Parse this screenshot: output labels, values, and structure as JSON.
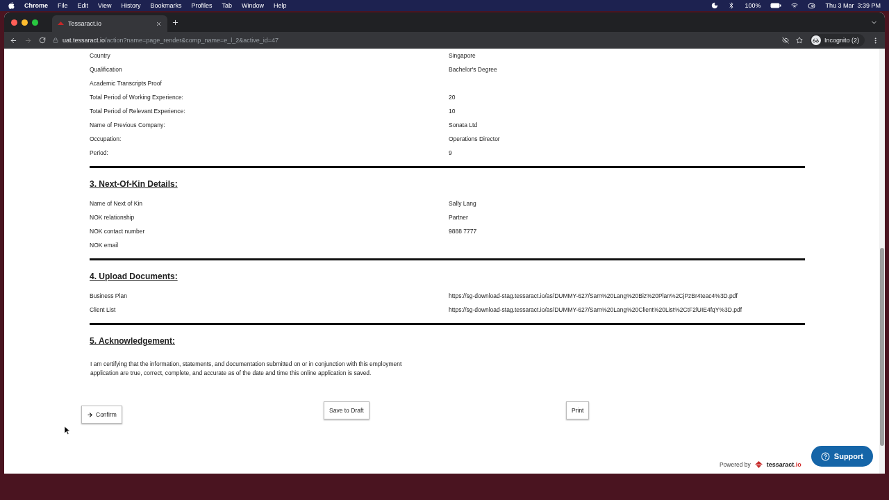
{
  "menu_bar": {
    "app": "Chrome",
    "items": [
      "File",
      "Edit",
      "View",
      "History",
      "Bookmarks",
      "Profiles",
      "Tab",
      "Window",
      "Help"
    ],
    "battery": "100%",
    "clock": "Thu 3 Mar  3:39 PM"
  },
  "browser": {
    "tab": {
      "title": "Tessaract.io",
      "selected": true
    },
    "url_host": "uat.tessaract.io",
    "url_path": "/action?name=page_render&comp_name=e_l_2&active_id=47",
    "profile": "Incognito (2)"
  },
  "sections": [
    {
      "rows": [
        {
          "label": "Country",
          "value": "Singapore"
        },
        {
          "label": "Qualification",
          "value": "Bachelor's Degree"
        },
        {
          "label": "Academic Transcripts Proof"
        },
        {
          "label": "Total Period of Working Experience:",
          "value": "20"
        },
        {
          "label": "Total Period of Relevant Experience:",
          "value": "10"
        },
        {
          "label": "Name of Previous Company:",
          "value": "Sonata Ltd"
        },
        {
          "label": "Occupation:",
          "value": "Operations Director"
        },
        {
          "label": "Period:",
          "value": "9"
        }
      ]
    },
    {
      "title": "3. Next-Of-Kin Details:",
      "rows": [
        {
          "label": "Name of Next of Kin",
          "value": "Sally Lang"
        },
        {
          "label": "NOK relationship",
          "value": "Partner"
        },
        {
          "label": "NOK contact number",
          "value": "9888 7777"
        },
        {
          "label": "NOK email"
        }
      ]
    },
    {
      "title": "4. Upload Documents:",
      "rows": [
        {
          "label": "Business Plan",
          "value": "https://sg-download-stag.tessaract.io/as/DUMMY-627/Sam%20Lang%20Biz%20Plan%2CjPzBr4teac4%3D.pdf"
        },
        {
          "label": "Client List",
          "value": "https://sg-download-stag.tessaract.io/as/DUMMY-627/Sam%20Lang%20Client%20List%2CtF2lUIE4fqY%3D.pdf"
        }
      ]
    },
    {
      "title": "5. Acknowledgement:",
      "text": "I am certifying that the information, statements, and documentation submitted on or in conjunction with this employment application are true, correct, complete, and accurate as of the date and time this online application is saved."
    }
  ],
  "buttons": {
    "confirm": "Confirm",
    "draft": "Save to Draft",
    "print": "Print"
  },
  "footer": {
    "powered": "Powered by",
    "brand": "tessaract",
    "brand_suffix": ".io",
    "support": "Support"
  }
}
